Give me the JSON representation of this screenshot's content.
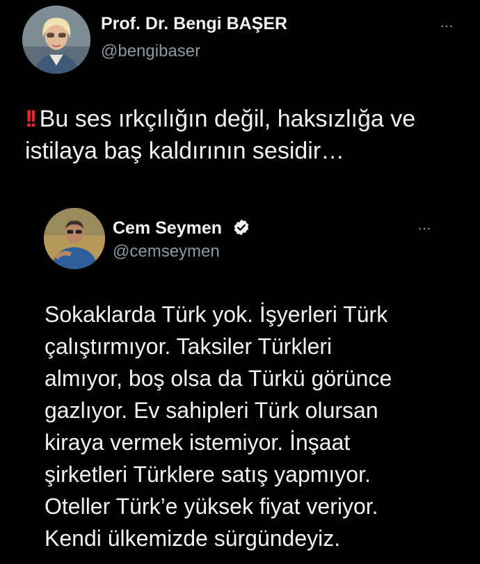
{
  "tweet": {
    "author_name": "Prof. Dr. Bengi BAŞER",
    "author_handle": "@bengibaser",
    "more_label": "···",
    "alert_emoji": "!!",
    "text": "Bu ses ırkçılığın değil, haksızlığa ve istilaya baş kaldırının sesidir…"
  },
  "quoted_tweet": {
    "author_name": "Cem Seymen",
    "author_handle": "@cemseymen",
    "more_label": "···",
    "lines": [
      "Sokaklarda Türk yok. İşyerleri Türk",
      "çalıştırmıyor. Taksiler Türkleri",
      "almıyor, boş  olsa da Türkü görünce",
      "gazlıyor. Ev sahipleri Türk olursan",
      "kiraya vermek istemiyor. İnşaat",
      "şirketleri Türklere satış yapmıyor.",
      "Oteller Türk’e yüksek fiyat veriyor.",
      "Kendi ülkemizde sürgündeyiz."
    ]
  },
  "colors": {
    "background": "#000000",
    "text": "#f2f2f2",
    "secondary": "#8b98a5",
    "alert": "#e8262c"
  }
}
